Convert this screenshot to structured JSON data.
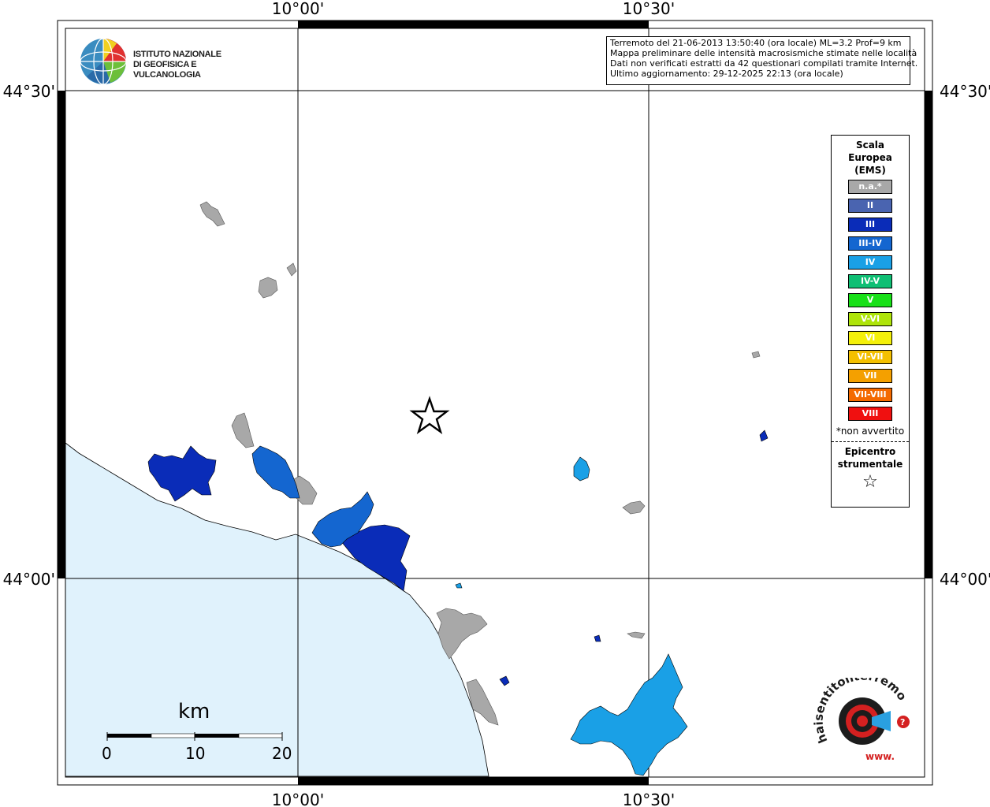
{
  "map": {
    "lon_labels_top": [
      "10°00'",
      "10°30'"
    ],
    "lon_labels_bottom": [
      "10°00'",
      "10°30'"
    ],
    "lat_labels_left": [
      "44°30'",
      "44°00'"
    ],
    "lat_labels_right": [
      "44°30'",
      "44°00'"
    ],
    "sea_color": "#e0f2fc",
    "land_color": "#ffffff"
  },
  "logo": {
    "line1": "ISTITUTO NAZIONALE",
    "line2": "DI GEOFISICA E VULCANOLOGIA"
  },
  "info": {
    "line1": "Terremoto del 21-06-2013 13:50:40 (ora locale) ML=3.2 Prof=9 km",
    "line2": "Mappa preliminare delle intensità macrosismiche stimate nelle località",
    "line3": "Dati non verificati estratti da 42 questionari compilati tramite Internet.",
    "line4": "Ultimo aggiornamento: 29-12-2025 22:13 (ora locale)"
  },
  "legend": {
    "title1": "Scala",
    "title2": "Europea",
    "title3": "(EMS)",
    "items": [
      {
        "label": "n.a.*",
        "color": "#a8a8a8"
      },
      {
        "label": "II",
        "color": "#4a64b0"
      },
      {
        "label": "III",
        "color": "#0a2cb8"
      },
      {
        "label": "III-IV",
        "color": "#1466d0"
      },
      {
        "label": "IV",
        "color": "#1aa0e6"
      },
      {
        "label": "IV-V",
        "color": "#0fbf74"
      },
      {
        "label": "V",
        "color": "#18e018"
      },
      {
        "label": "V-VI",
        "color": "#aee40a"
      },
      {
        "label": "VI",
        "color": "#f4f00a"
      },
      {
        "label": "VI-VII",
        "color": "#f4c000"
      },
      {
        "label": "VII",
        "color": "#f4a000"
      },
      {
        "label": "VII-VIII",
        "color": "#f46a00"
      },
      {
        "label": "VIII",
        "color": "#f01010"
      }
    ],
    "note": "*non avvertito",
    "epicenter1": "Epicentro",
    "epicenter2": "strumentale",
    "epicenter_symbol": "☆"
  },
  "scale_bar": {
    "unit": "km",
    "ticks": [
      "0",
      "10",
      "20"
    ]
  },
  "site_logo": {
    "text": "haisentitoilterremoto.it",
    "url_text": "www."
  }
}
